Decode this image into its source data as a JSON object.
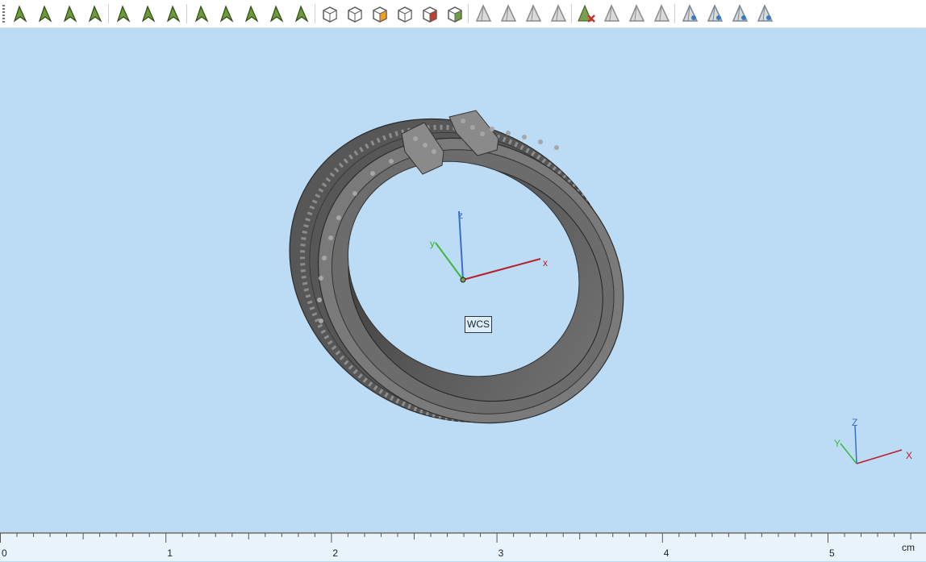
{
  "toolbar": {
    "groups": [
      {
        "icons": [
          "select-arrow-icon",
          "select-face-icon",
          "select-edge-icon",
          "select-solid-icon"
        ]
      },
      {
        "icons": [
          "rectangle-curve-icon",
          "spline-curve-icon",
          "freeform-curve-icon"
        ]
      },
      {
        "icons": [
          "mesh-surface-icon",
          "loft-surface-icon",
          "network-surface-icon",
          "revolve-surface-icon",
          "sweep-surface-icon"
        ]
      },
      {
        "icons": [
          "box-solid-icon",
          "cube-solid-icon",
          "colored-cube-icon",
          "wire-cube-icon",
          "cube-red-icon",
          "cube-green-icon"
        ]
      },
      {
        "icons": [
          "pyramid-icon",
          "pyramid-faceted-icon",
          "pyramid-arrow-icon",
          "pyramid-rotate-icon"
        ]
      },
      {
        "icons": [
          "delete-red-x-icon",
          "pyramid-grid-icon",
          "pyramid-copy-icon",
          "pyramid-slanted-icon"
        ]
      },
      {
        "icons": [
          "view-eye-icon",
          "view-layers-icon",
          "view-eye-blue-icon",
          "view-hatch-icon"
        ]
      }
    ]
  },
  "viewport": {
    "background": "#bcdcf6",
    "wcs_label": "WCS",
    "axes": {
      "x": "x",
      "y": "y",
      "z": "z"
    },
    "corner_axes": {
      "x": "X",
      "y": "Y",
      "z": "Z"
    },
    "axis_colors": {
      "x": "#c0202a",
      "y": "#38b838",
      "z": "#3a6fc4"
    }
  },
  "ruler": {
    "unit": "cm",
    "labels": [
      "0",
      "1",
      "2",
      "3",
      "4",
      "5"
    ]
  }
}
